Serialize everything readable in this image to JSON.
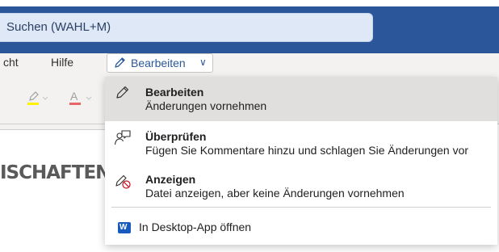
{
  "search": {
    "placeholder": "Suchen (WAHL+M)"
  },
  "tabs": {
    "ansicht": "cht",
    "hilfe": "Hilfe"
  },
  "mode_button": {
    "label": "Bearbeiten",
    "chevron": "∨"
  },
  "ribbon": {
    "icons": [
      "highlighter-icon",
      "font-color-icon"
    ],
    "font_color_letter": "A"
  },
  "document": {
    "heading": "ISCHAFTEN"
  },
  "menu": {
    "items": [
      {
        "title": "Bearbeiten",
        "description": "Änderungen vornehmen",
        "icon": "pencil-icon",
        "selected": true
      },
      {
        "title": "Überprüfen",
        "description": "Fügen Sie Kommentare hinzu und schlagen Sie Änderungen vor",
        "icon": "review-icon"
      },
      {
        "title": "Anzeigen",
        "description": "Datei anzeigen, aber keine Änderungen vornehmen",
        "icon": "view-only-icon"
      }
    ],
    "desktop": {
      "label": "In Desktop-App öffnen",
      "icon": "word-icon",
      "icon_letter": "W"
    }
  },
  "colors": {
    "titlebar": "#2b579a",
    "accent": "#2b579a",
    "selected_bg": "#e1dfdd"
  }
}
